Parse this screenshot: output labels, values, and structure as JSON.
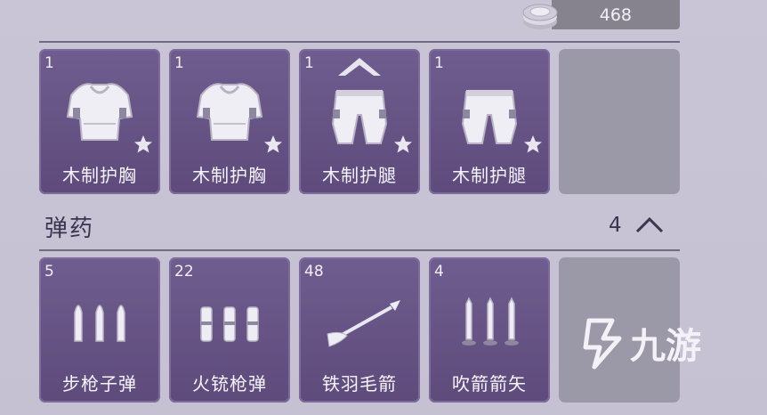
{
  "currency": {
    "value": "468",
    "icon": "silver-coin-icon"
  },
  "armor_items": [
    {
      "qty": "1",
      "name": "木制护胸",
      "icon": "chest-armor-icon"
    },
    {
      "qty": "1",
      "name": "木制护胸",
      "icon": "chest-armor-icon"
    },
    {
      "qty": "1",
      "name": "木制护腿",
      "icon": "leg-armor-icon"
    },
    {
      "qty": "1",
      "name": "木制护腿",
      "icon": "leg-armor-icon"
    }
  ],
  "ammo_section": {
    "title": "弹药",
    "count": "4"
  },
  "ammo_items": [
    {
      "qty": "5",
      "name": "步枪子弹",
      "icon": "rifle-bullets-icon"
    },
    {
      "qty": "22",
      "name": "火铳枪弹",
      "icon": "musket-rounds-icon"
    },
    {
      "qty": "48",
      "name": "铁羽毛箭",
      "icon": "feather-arrow-icon"
    },
    {
      "qty": "4",
      "name": "吹箭箭矢",
      "icon": "blowgun-darts-icon"
    }
  ],
  "watermark": {
    "text": "九游"
  }
}
